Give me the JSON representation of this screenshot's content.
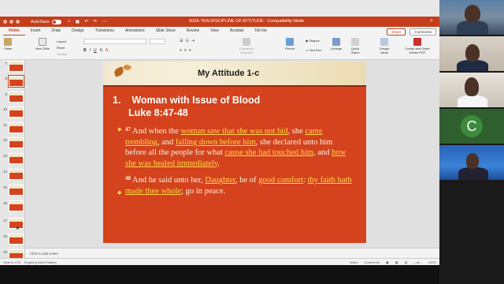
{
  "window": {
    "title": "002A-TEN DISCIPLINE OF ATTITUDE  -  Compatibility Mode",
    "autosave_label": "AutoSave",
    "autosave_state": "OFF"
  },
  "tabs": [
    "Home",
    "Insert",
    "Draw",
    "Design",
    "Transitions",
    "Animations",
    "Slide Show",
    "Review",
    "View",
    "Acrobat",
    "Tell me"
  ],
  "share_label": "Share",
  "comments_label": "Comments",
  "ribbon": {
    "paste": "Paste",
    "new_slide": "New Slide",
    "layout": "Layout",
    "reset": "Reset",
    "section": "Section",
    "convert_smartart": "Convert to SmartArt",
    "picture": "Picture",
    "shapes": "Shapes",
    "text_box": "Text Box",
    "arrange": "Arrange",
    "quick_styles": "Quick Styles",
    "design_ideas": "Design Ideas",
    "create_share_pdf": "Create and Share Adobe PDF"
  },
  "thumbnails": [
    {
      "num": "7"
    },
    {
      "num": "8",
      "selected": true
    },
    {
      "num": "9"
    },
    {
      "num": "10"
    },
    {
      "num": "11"
    },
    {
      "num": "12"
    },
    {
      "num": "13"
    },
    {
      "num": "14"
    },
    {
      "num": "15"
    },
    {
      "num": "16"
    },
    {
      "num": "17"
    },
    {
      "num": "18"
    },
    {
      "num": "19"
    }
  ],
  "slide": {
    "title": "My Attitude 1-c",
    "heading_line1": "1.    Woman with Issue of Blood",
    "heading_line2": "Luke 8:47-48",
    "v47_num": "47",
    "v48_num": "48"
  },
  "notes_placeholder": "Click to add notes",
  "status": {
    "slide_of": "Slide 8 of 23",
    "language": "English (United States)",
    "notes": "Notes",
    "comments": "Comments",
    "zoom": "120%"
  },
  "video": {
    "tile4_initial": "C"
  }
}
